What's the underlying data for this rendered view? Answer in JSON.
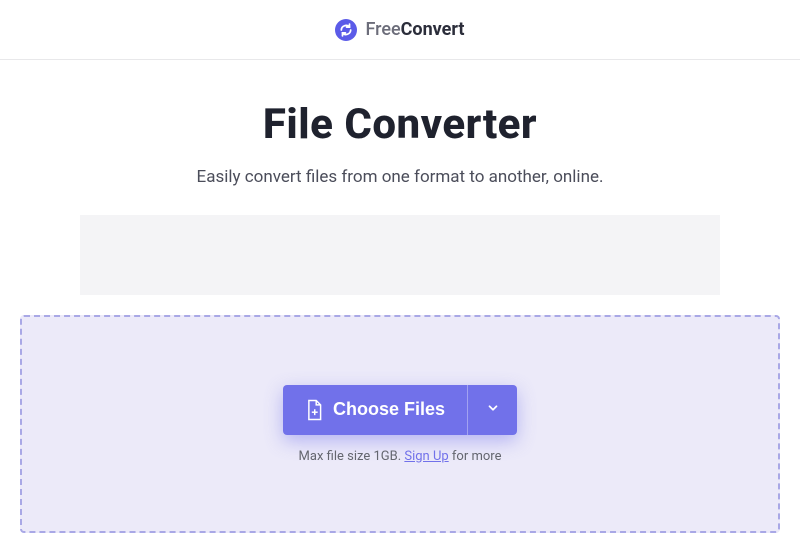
{
  "header": {
    "brand_first": "Free",
    "brand_second": "Convert"
  },
  "main": {
    "title": "File Converter",
    "subtitle": "Easily convert files from one format to another, online."
  },
  "dropzone": {
    "choose_label": "Choose Files",
    "hint_prefix": "Max file size 1GB. ",
    "signup_label": "Sign Up",
    "hint_suffix": " for more"
  }
}
